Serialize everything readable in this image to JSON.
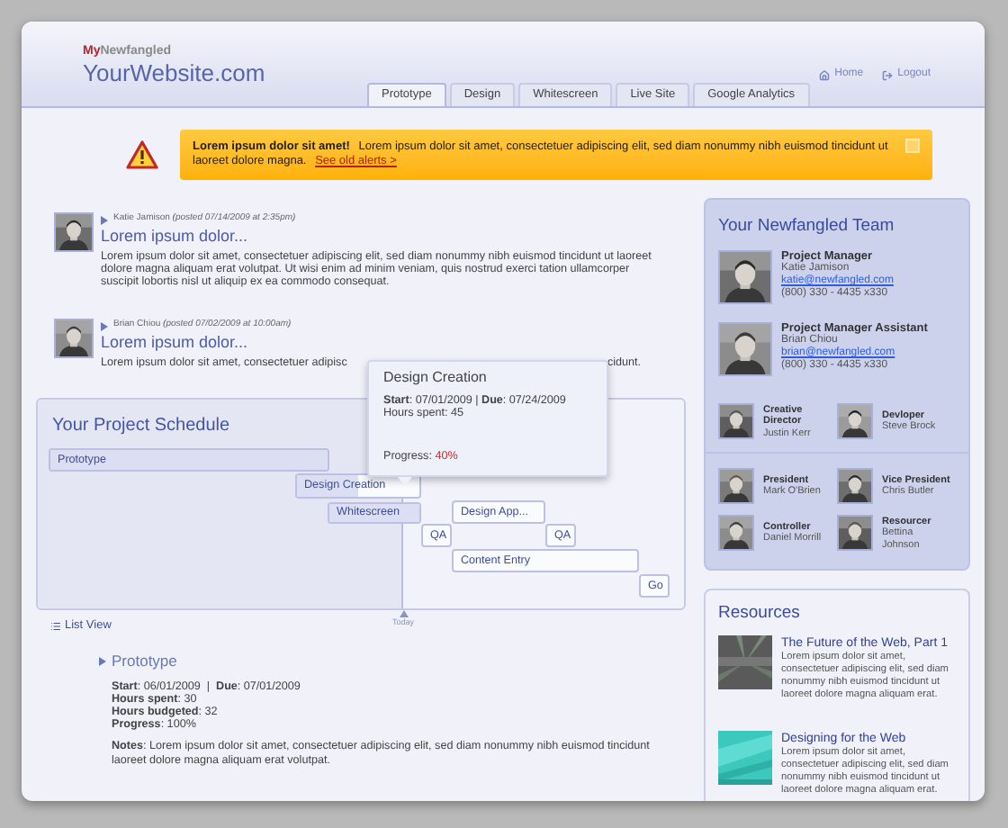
{
  "header": {
    "brand_prefix": "My",
    "brand_name": "Newfangled",
    "site_title": "YourWebsite.com",
    "links": [
      {
        "label": "Home",
        "kind": "home"
      },
      {
        "label": "Logout",
        "kind": "logout"
      }
    ]
  },
  "tabs": [
    {
      "label": "Prototype",
      "selected": true
    },
    {
      "label": "Design",
      "selected": false
    },
    {
      "label": "Whitescreen",
      "selected": false
    },
    {
      "label": "Live Site",
      "selected": false
    },
    {
      "label": "Google Analytics",
      "selected": false
    }
  ],
  "alert": {
    "title": "Lorem ipsum dolor sit amet!",
    "message": "Lorem ipsum dolor sit amet, consectetuer adipiscing elit, sed diam nonummy nibh euismod tincidunt ut laoreet dolore magna.",
    "link": "See old alerts >"
  },
  "posts": [
    {
      "author": "Katie Jamison",
      "posted": "(posted 07/14/2009 at 2:35pm)",
      "title": "Lorem ipsum dolor...",
      "body_parts": [
        "Lorem ipsum dolor sit amet, consectetuer adipiscing elit, sed diam nonummy nibh euismod tincidunt ut laoreet dolore magna aliquam erat volutpat. Ut wisi enim ad minim veniam, quis nostrud exerci tation ullamcorper suscipit lobortis nisl ut aliquip ex ea commodo consequat."
      ]
    },
    {
      "author": "Brian Chiou",
      "posted": "(posted 07/02/2009 at 10:00am)",
      "title": "Lorem ipsum dolor...",
      "body_parts": [
        "Lorem ipsum dolor sit amet, consectetuer adipisc",
        "cidunt."
      ]
    }
  ],
  "schedule": {
    "title": "Your Project Schedule",
    "today_label": "Today",
    "tasks": [
      {
        "label": "Prototype",
        "level": 1
      },
      {
        "label": "Design Creation",
        "level": 0.5
      },
      {
        "label": "Whitescreen",
        "level": 1
      },
      {
        "label": "Design App..."
      },
      {
        "label": "QA"
      },
      {
        "label": "QA"
      },
      {
        "label": "Content Entry"
      },
      {
        "label": "Go"
      }
    ]
  },
  "tooltip": {
    "title": "Design Creation",
    "lines": [
      "**Start**: 07/01/2009 | **Due**: 07/24/2009",
      "Hours spent: 45"
    ],
    "progress_label": "Progress:",
    "progress": "40%"
  },
  "list_view": "List View",
  "details": {
    "title": "Prototype",
    "lines": [
      "**Start**: 06/01/2009  |  **Due**: 07/01/2009",
      "**Hours spent**: 30",
      "**Hours budgeted**: 32",
      "**Progress**: 100%"
    ],
    "notes": "**Notes**: Lorem ipsum dolor sit amet, consectetuer adipiscing elit, sed diam nonummy nibh euismod tincidunt laoreet dolore magna aliquam erat volutpat."
  },
  "team": {
    "title": "Your Newfangled Team",
    "leads": [
      {
        "role": "Project Manager",
        "name": "Katie Jamison",
        "email": "katie@newfangled.com",
        "phone": "(800) 330 - 4435 x330"
      },
      {
        "role": "Project Manager Assistant",
        "name": "Brian Chiou",
        "email": "brian@newfangled.com",
        "phone": "(800) 330 - 4435 x330"
      }
    ],
    "member_groups": [
      [
        {
          "role": "Creative Director",
          "name": "Justin Kerr"
        },
        {
          "role": "Devloper",
          "name": "Steve Brock"
        }
      ],
      [
        {
          "role": "President",
          "name": "Mark O'Brien"
        },
        {
          "role": "Vice President",
          "name": "Chris Butler"
        },
        {
          "role": "Controller",
          "name": "Daniel Morrill"
        },
        {
          "role": "Resourcer",
          "name": "Bettina Johnson"
        }
      ]
    ]
  },
  "resources": {
    "title": "Resources",
    "items": [
      {
        "title": "The Future of the Web, Part 1",
        "description": "Lorem ipsum dolor sit amet, consectetuer adipiscing elit, sed diam nonummy nibh euismod tincidunt ut laoreet dolore magna aliquam erat."
      },
      {
        "title": "Designing for the Web",
        "description": "Lorem ipsum dolor sit amet, consectetuer adipiscing elit, sed diam nonummy nibh euismod tincidunt ut laoreet dolore magna aliquam erat."
      }
    ]
  }
}
